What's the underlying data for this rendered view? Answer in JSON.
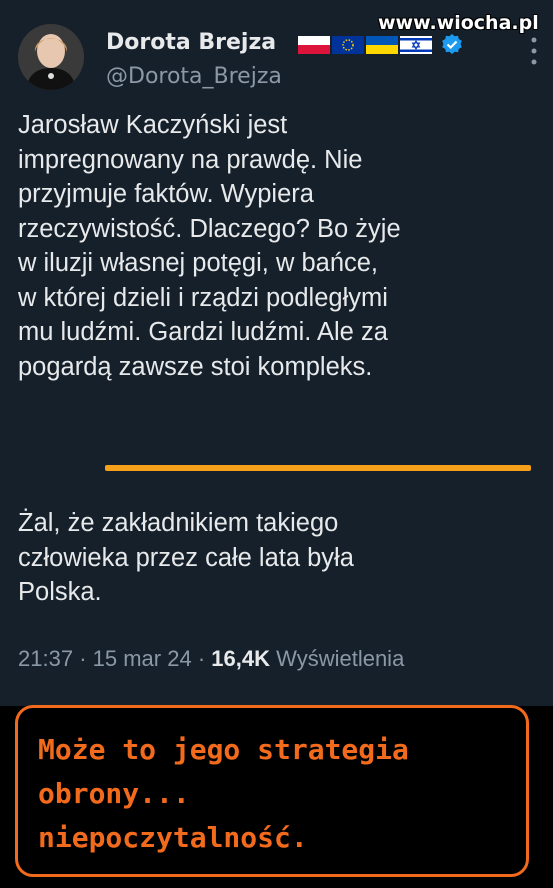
{
  "watermark": "www.wiocha.pl",
  "tweet": {
    "author_name": "Dorota Brejza",
    "handle": "@Dorota_Brejza",
    "flags": [
      "poland-flag",
      "eu-flag",
      "ukraine-flag",
      "israel-flag"
    ],
    "verified_icon": "verified-badge-icon",
    "paragraph1_lines": [
      "Jarosław Kaczyński jest",
      "impregnowany na prawdę. Nie",
      "przyjmuje faktów. Wypiera",
      "rzeczywistość. Dlaczego? Bo żyje",
      "w iluzji własnej potęgi, w bańce,",
      "w której dzieli i rządzi podległymi",
      "mu ludźmi. Gardzi ludźmi. Ale za",
      "pogardą zawsze stoi kompleks."
    ],
    "paragraph2_lines": [
      "Żal, że zakładnikiem takiego",
      "człowieka przez całe lata była",
      "Polska."
    ],
    "time": "21:37",
    "date": "15 mar 24",
    "views_count": "16,4K",
    "views_label": "Wyświetlenia",
    "separator": "·"
  },
  "caption": {
    "lines": [
      "Może to jego strategia",
      "obrony...",
      "niepoczytalność."
    ]
  },
  "colors": {
    "background": "#15202b",
    "text": "#e7e9ea",
    "secondary": "#8b98a5",
    "underline": "#f7a01c",
    "caption": "#f26b1d",
    "verified": "#1d9bf0"
  }
}
